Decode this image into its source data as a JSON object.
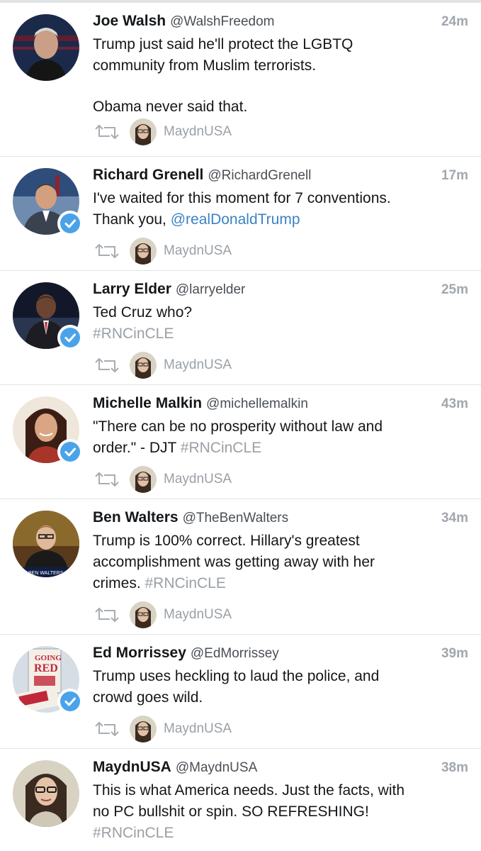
{
  "tweets": [
    {
      "name": "Joe Walsh",
      "handle": "@WalshFreedom",
      "time": "24m",
      "line1": "Trump just said he'll protect the LGBTQ",
      "line2": "community from Muslim terrorists.",
      "line3": "Obama never said that.",
      "retweeted_by": "MaydnUSA",
      "verified": false
    },
    {
      "name": "Richard Grenell",
      "handle": "@RichardGrenell",
      "time": "17m",
      "line1": "I've waited for this moment for 7 conventions.",
      "line2_prefix": "Thank you, ",
      "mention": "@realDonaldTrump",
      "retweeted_by": "MaydnUSA",
      "verified": true
    },
    {
      "name": "Larry Elder",
      "handle": "@larryelder",
      "time": "25m",
      "line1": "Ted Cruz who?",
      "hashtag": "#RNCinCLE",
      "retweeted_by": "MaydnUSA",
      "verified": true
    },
    {
      "name": "Michelle Malkin",
      "handle": "@michellemalkin",
      "time": "43m",
      "line1": "\"There can be no prosperity without law and",
      "line2_prefix": "order.\" - DJT ",
      "hashtag": "#RNCinCLE",
      "retweeted_by": "MaydnUSA",
      "verified": true
    },
    {
      "name": "Ben Walters",
      "handle": "@TheBenWalters",
      "time": "34m",
      "line1": "Trump is 100% correct. Hillary's greatest",
      "line2": "accomplishment was getting away with her",
      "line3_prefix": "crimes. ",
      "hashtag": "#RNCinCLE",
      "avatar_caption": "BEN WALTERS",
      "retweeted_by": "MaydnUSA",
      "verified": false
    },
    {
      "name": "Ed Morrissey",
      "handle": "@EdMorrissey",
      "time": "39m",
      "line1": "Trump uses heckling to laud the police, and",
      "line2": "crowd goes wild.",
      "avatar_book_line1": "GOING",
      "avatar_book_line2": "RED",
      "retweeted_by": "MaydnUSA",
      "verified": true
    },
    {
      "name": "MaydnUSA",
      "handle": "@MaydnUSA",
      "time": "38m",
      "line1": "This is what America needs. Just the facts, with",
      "line2": "no PC bullshit or spin. SO REFRESHING!",
      "hashtag": "#RNCinCLE",
      "verified": false
    }
  ],
  "colors": {
    "name": "#14171a",
    "time": "#a1a7ad",
    "link": "#3b83c4",
    "hashtag": "#9aa0a6",
    "verified": "#4aa3e8",
    "divider": "#e1e4e6"
  },
  "icons": {
    "retweet": "retweet-icon",
    "verified": "verified-badge-icon"
  }
}
